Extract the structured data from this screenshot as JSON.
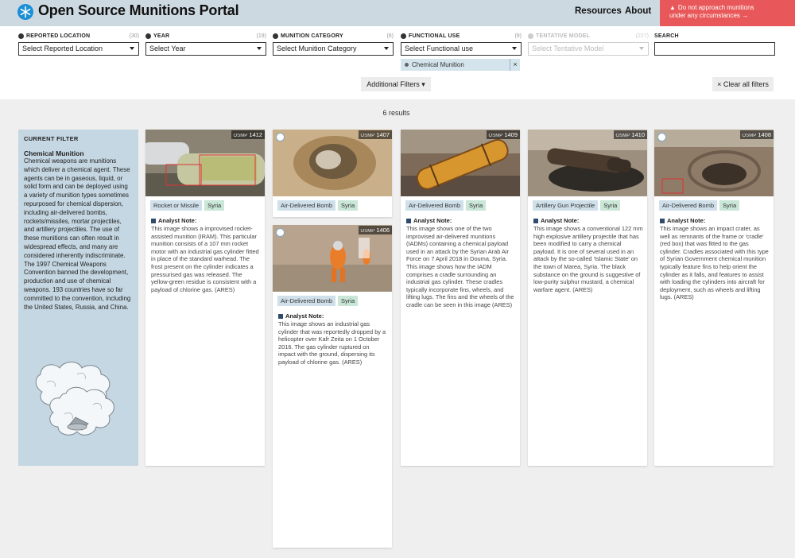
{
  "header": {
    "title": "Open Source Munitions Portal",
    "nav": {
      "resources": "Resources",
      "about": "About"
    },
    "warning_line1": "Do not approach munitions",
    "warning_line2": "under any circumstances →",
    "warning_icon": "▲"
  },
  "filters": {
    "location": {
      "label": "Reported Location",
      "count": "(30)",
      "value": "Select Reported Location"
    },
    "year": {
      "label": "Year",
      "count": "(19)",
      "value": "Select Year"
    },
    "category": {
      "label": "Munition Category",
      "count": "(8)",
      "value": "Select Munition Category"
    },
    "use": {
      "label": "Functional Use",
      "count": "(9)",
      "value": "Select Functional use"
    },
    "model": {
      "label": "Tentative Model",
      "count": "(227)",
      "value": "Select Tentative Model"
    },
    "search": {
      "label": "Search",
      "value": ""
    },
    "active_chip": "Chemical Munition",
    "chip_remove": "×",
    "additional": "Additional Filters ▾",
    "clear_all": "× Clear all filters"
  },
  "results": {
    "text": "6 results"
  },
  "current_filter": {
    "heading": "CURRENT FILTER",
    "name": "Chemical Munition",
    "description": "Chemical weapons are munitions which deliver a chemical agent. These agents can be in gaseous, liquid, or solid form and can be deployed using a variety of munition types sometimes repurposed for chemical dispersion, including air-delivered bombs, rockets/missiles, mortar projectiles, and artillery projectiles. The use of these munitions can often result in widespread effects, and many are considered inherently indiscriminate. The 1997 Chemical Weapons Convention banned the development, production and use of chemical weapons. 193 countries have so far committed to the convention, including the United States, Russia, and China."
  },
  "cards": [
    {
      "id_prefix": "OSMP",
      "id": "1412",
      "type": "Rocket or Missile",
      "country": "Syria",
      "note_label": "Analyst Note:",
      "note": "This image shows a improvised rocket-assisted munition (IRAM). This particular munition consists of a 107 mm rocket motor with an industrial gas cylinder fitted in place of the standard warhead. The frost present on the cylinder indicates a pressurised gas was released. The yellow-green residue is consistent with a payload of chlorine gas. (ARES)"
    },
    {
      "id_prefix": "OSMP",
      "id": "1407",
      "type": "Air-Delivered Bomb",
      "country": "Syria",
      "note_label": "",
      "note": ""
    },
    {
      "id_prefix": "OSMP",
      "id": "1406",
      "type": "Air-Delivered Bomb",
      "country": "Syria",
      "note_label": "Analyst Note:",
      "note": "This image shows an industrial gas cylinder that was reportedly dropped by a helicopter over Kafr Zeita on 1 October 2016. The gas cylinder ruptured on impact with the ground, dispersing its payload of chlorine gas. (ARES)"
    },
    {
      "id_prefix": "OSMP",
      "id": "1409",
      "type": "Air-Delivered Bomb",
      "country": "Syria",
      "note_label": "Analyst Note:",
      "note": "This image shows one of the two improvised air-delivered munitions (IADMs) containing a chemical payload used in an attack by the Syrian Arab Air Force on 7 April 2018 in Douma, Syria. This image shows how the IADM comprises a cradle surrounding an industrial gas cylinder. These cradles typically incorporate fins, wheels, and lifting lugs. The fins and the wheels of the cradle can be seen in this image (ARES)"
    },
    {
      "id_prefix": "OSMP",
      "id": "1410",
      "type": "Artillery Gun Projectile",
      "country": "Syria",
      "note_label": "Analyst Note:",
      "note": "This image shows a conventional 122 mm high explosive artillery projectile that has been modified to carry a chemical payload. It is one of several used in an attack by the so-called 'Islamic State' on the town of Marea, Syria. The black substance on the ground is suggestive of low-purity sulphur mustard, a chemical warfare agent. (ARES)"
    },
    {
      "id_prefix": "OSMP",
      "id": "1408",
      "type": "Air-Delivered Bomb",
      "country": "Syria",
      "note_label": "Analyst Note:",
      "note": "This image shows an impact crater, as well as remnants of the frame or 'cradle' (red box) that was fitted to the gas cylinder. Cradles associated with this type of Syrian Government chemical munition typically feature fins to help orient the cylinder as it falls, and features to assist with loading the cylinders into aircraft for deployment, such as wheels and lifting lugs. (ARES)"
    }
  ],
  "icons": {
    "logo": "snowflake-icon",
    "caret": "chevron-down-icon",
    "info": "info-icon",
    "note": "note-icon"
  },
  "colors": {
    "header_bg": "#cdd9e1",
    "warning_bg": "#e8585a",
    "panel_bg": "#c5d7e2",
    "tag_type": "#d0e0ea",
    "tag_country": "#c9e6d6",
    "logo": "#1a8fd6"
  }
}
